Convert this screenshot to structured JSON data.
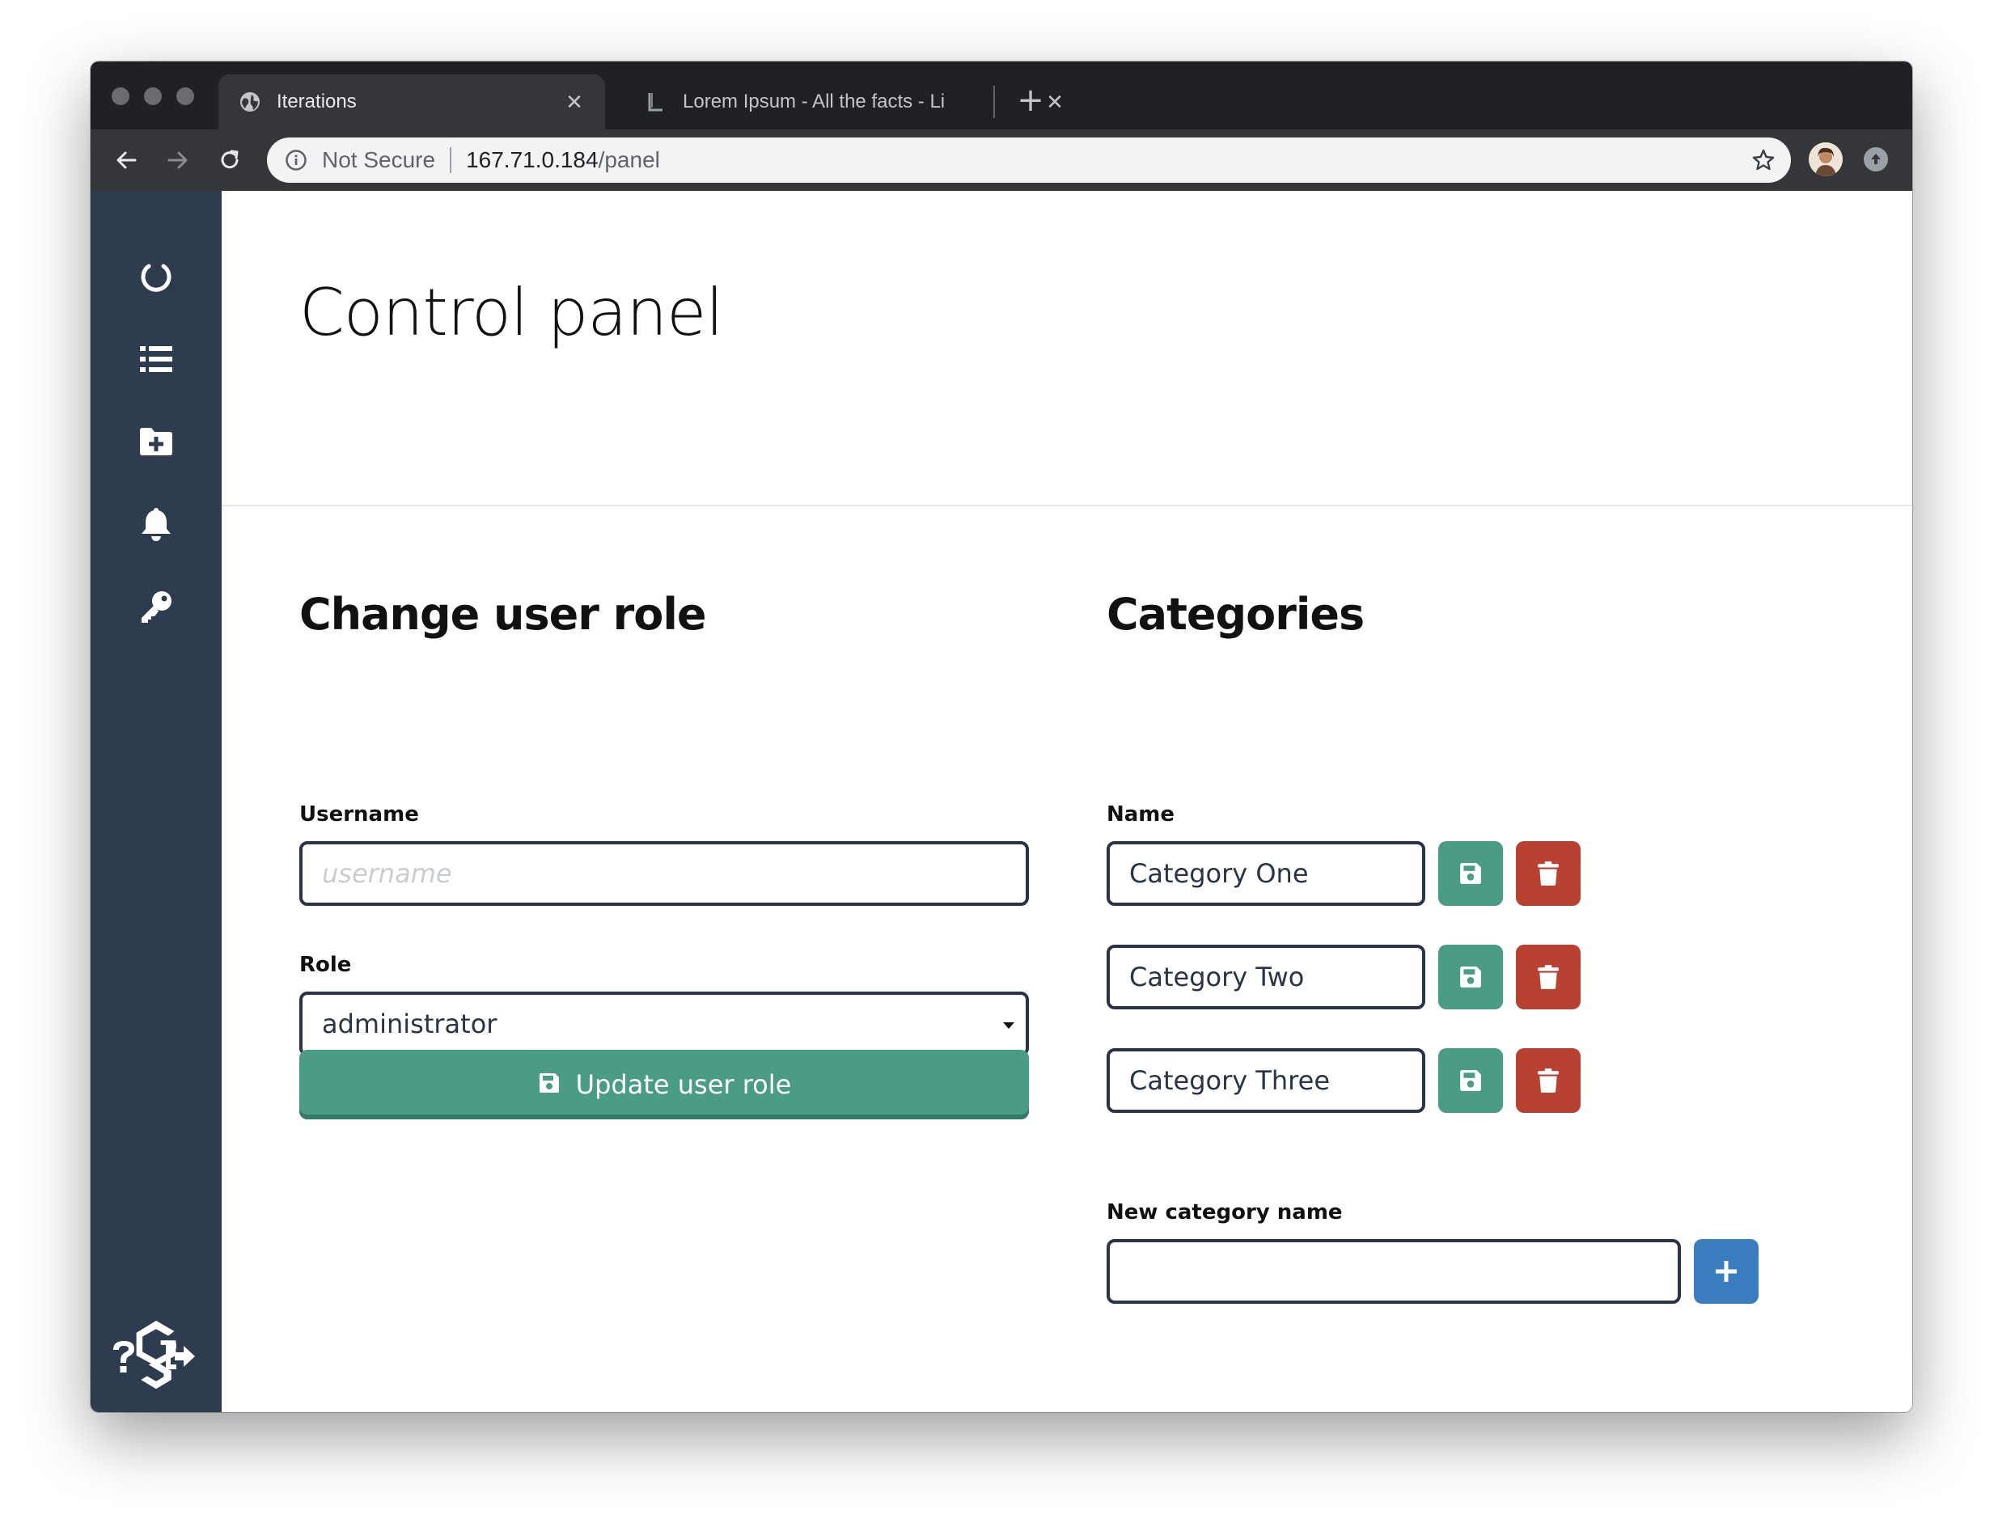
{
  "browser": {
    "tabs": [
      {
        "title": "Iterations",
        "active": true,
        "favicon": "globe-icon"
      },
      {
        "title": "Lorem Ipsum - All the facts - Li",
        "active": false,
        "favicon": "lipsum-favicon-icon"
      }
    ],
    "address": {
      "security_label": "Not Secure",
      "host": "167.71.0.184",
      "path": "/panel"
    }
  },
  "sidebar": {
    "items": [
      {
        "icon": "refresh-circle-icon"
      },
      {
        "icon": "list-icon"
      },
      {
        "icon": "folder-plus-icon"
      },
      {
        "icon": "bell-icon"
      },
      {
        "icon": "key-icon"
      }
    ],
    "bottom": [
      {
        "icon": "app-logo-icon"
      },
      {
        "icon": "help-icon"
      },
      {
        "icon": "sign-out-icon"
      }
    ]
  },
  "page": {
    "title": "Control panel"
  },
  "change_role": {
    "heading": "Change user role",
    "username_label": "Username",
    "username_placeholder": "username",
    "role_label": "Role",
    "role_value": "administrator",
    "submit_label": "Update user role"
  },
  "categories": {
    "heading": "Categories",
    "name_label": "Name",
    "items": [
      {
        "name": "Category One"
      },
      {
        "name": "Category Two"
      },
      {
        "name": "Category Three"
      }
    ],
    "new_label": "New category name",
    "new_value": ""
  },
  "colors": {
    "sidebar": "#2e3c4f",
    "success": "#4a9d84",
    "danger": "#b84232",
    "primary": "#3a7ebf"
  }
}
